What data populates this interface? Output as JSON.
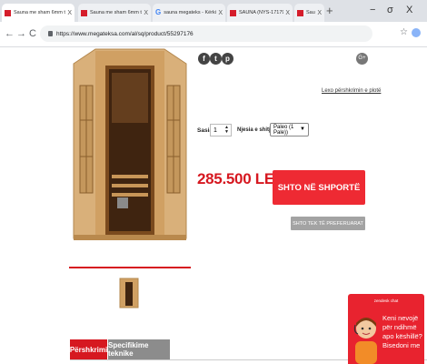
{
  "browser": {
    "tabs": [
      {
        "title": "Sauna me sham 6mm te temp",
        "favicon": "red-square-icon"
      },
      {
        "title": "Sauna me sham 6mm te temp",
        "favicon": "red-square-icon"
      },
      {
        "title": "sauna megateks - Kërkimi Goo",
        "favicon": "google-g-icon"
      },
      {
        "title": "SAUNA (NYS-171795 - megat",
        "favicon": "red-square-icon"
      },
      {
        "title": "Sauna me sham 6mm te temp",
        "favicon": "red-square-icon"
      }
    ],
    "tab_close": "X",
    "new_tab": "+",
    "window_controls": [
      "−",
      "σ",
      "X"
    ],
    "nav": {
      "back": "←",
      "forward": "→",
      "reload": "C"
    },
    "url": "https://www.megateksa.com/al/sq/product/55297176"
  },
  "product": {
    "social_icons": [
      "f",
      "t",
      "p"
    ],
    "gplus_icon": "G+",
    "compare_link": "Lexo përshkrimin e plotë",
    "quantity_label": "Sasia:",
    "quantity_value": "1",
    "variant_label": "Njesia e shitjes:",
    "variant_value": "Paleo (1 Pale))",
    "price": "285.500 LEK",
    "add_to_cart": "SHTO NË SHPORTË",
    "add_to_favorites": "SHTO TEK TË PREFERUARAT"
  },
  "tabs": {
    "description": "Përshkrimi",
    "specs": "Specifikime teknike"
  },
  "chat": {
    "brand": "zendesk chat",
    "message": "Keni nevojë për ndihmë apo këshillë? Bisedoni me"
  },
  "colors": {
    "accent_red": "#d61820",
    "cart_button": "#ee2a33",
    "wishlist_button": "#a3a3a3"
  }
}
